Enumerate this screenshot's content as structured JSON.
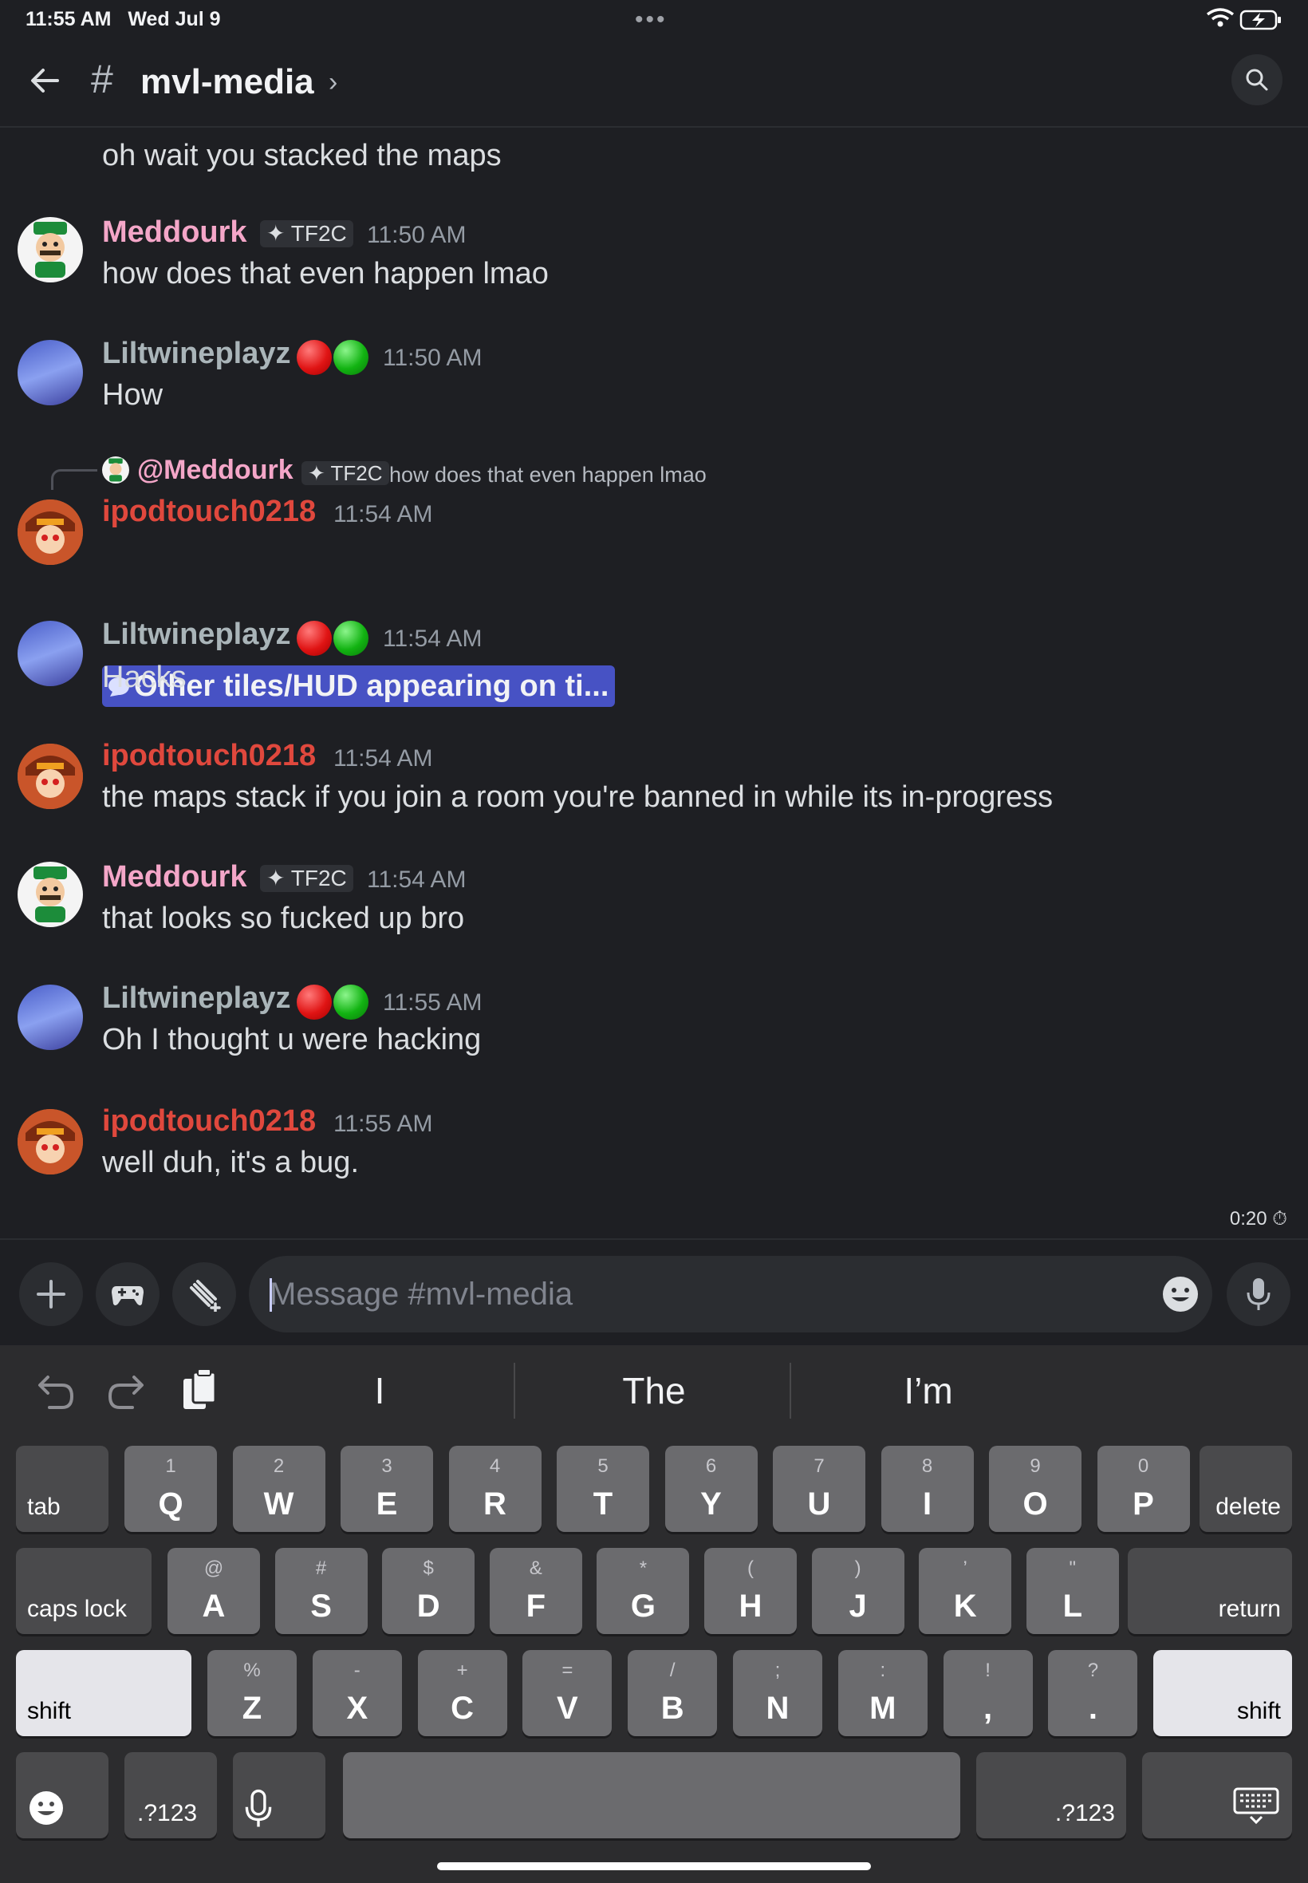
{
  "status": {
    "time": "11:55 AM",
    "date": "Wed Jul 9"
  },
  "header": {
    "hash": "#",
    "channel": "mvl-media",
    "chevron": "›"
  },
  "colors": {
    "background": "#1e1f23",
    "accent": "#4752c4",
    "meddourk": "#f4a6c8",
    "liltwine": "#aab5b9",
    "ipodtouch": "#e0483d"
  },
  "messages": {
    "m0": {
      "text": "oh wait you stacked the maps"
    },
    "m1": {
      "user": "Meddourk",
      "tag": "TF2C",
      "time": "11:50 AM",
      "text": "how does that even happen lmao"
    },
    "m2": {
      "user": "Liltwineplayz",
      "time": "11:50 AM",
      "text": "How"
    },
    "m3": {
      "reply": {
        "user": "@Meddourk",
        "tag": "TF2C",
        "text": "how does that even happen lmao"
      },
      "user": "ipodtouch0218",
      "time": "11:54 AM",
      "thread": "Other tiles/HUD appearing on ti..."
    },
    "m4": {
      "user": "Liltwineplayz",
      "time": "11:54 AM",
      "text": "Hacks"
    },
    "m5": {
      "user": "ipodtouch0218",
      "time": "11:54 AM",
      "text": "the maps stack if you join a room you're banned in while its in-progress"
    },
    "m6": {
      "user": "Meddourk",
      "tag": "TF2C",
      "time": "11:54 AM",
      "text": "that looks so fucked up bro"
    },
    "m7": {
      "user": "Liltwineplayz",
      "time": "11:55 AM",
      "text": "Oh I thought  u were hacking"
    },
    "m8": {
      "user": "ipodtouch0218",
      "time": "11:55 AM",
      "text": "well duh, it's a bug."
    }
  },
  "timer": "0:20",
  "composer": {
    "placeholder": "Message #mvl-media"
  },
  "keyboard": {
    "suggestions": [
      "I",
      "The",
      "I’m"
    ],
    "row1": [
      {
        "k": "Q",
        "s": "1"
      },
      {
        "k": "W",
        "s": "2"
      },
      {
        "k": "E",
        "s": "3"
      },
      {
        "k": "R",
        "s": "4"
      },
      {
        "k": "T",
        "s": "5"
      },
      {
        "k": "Y",
        "s": "6"
      },
      {
        "k": "U",
        "s": "7"
      },
      {
        "k": "I",
        "s": "8"
      },
      {
        "k": "O",
        "s": "9"
      },
      {
        "k": "P",
        "s": "0"
      }
    ],
    "row2": [
      {
        "k": "A",
        "s": "@"
      },
      {
        "k": "S",
        "s": "#"
      },
      {
        "k": "D",
        "s": "$"
      },
      {
        "k": "F",
        "s": "&"
      },
      {
        "k": "G",
        "s": "*"
      },
      {
        "k": "H",
        "s": "("
      },
      {
        "k": "J",
        "s": ")"
      },
      {
        "k": "K",
        "s": "’"
      },
      {
        "k": "L",
        "s": "\""
      }
    ],
    "row3": [
      {
        "k": "Z",
        "s": "%"
      },
      {
        "k": "X",
        "s": "-"
      },
      {
        "k": "C",
        "s": "+"
      },
      {
        "k": "V",
        "s": "="
      },
      {
        "k": "B",
        "s": "/"
      },
      {
        "k": "N",
        "s": ";"
      },
      {
        "k": "M",
        "s": ":"
      },
      {
        "k": ",",
        "s": "!"
      },
      {
        "k": ".",
        "s": "?"
      }
    ],
    "tab": "tab",
    "delete": "delete",
    "caps": "caps lock",
    "return": "return",
    "shift": "shift",
    "num": ".?123"
  }
}
